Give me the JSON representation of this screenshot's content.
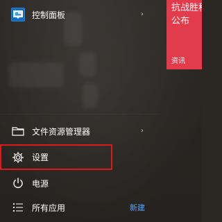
{
  "start_menu": {
    "control_panel": {
      "label": "控制面板",
      "icon": "control-panel-icon"
    },
    "file_explorer": {
      "label": "文件资源管理器",
      "icon": "folder-icon"
    },
    "settings": {
      "label": "设置",
      "icon": "gear-icon",
      "highlight_color": "#d81c1c"
    },
    "power": {
      "label": "电源",
      "icon": "power-icon"
    },
    "all_apps": {
      "label": "所有应用",
      "icon": "all-apps-icon"
    },
    "new_link": {
      "label": "新建",
      "color": "#55a7ff"
    },
    "chevron": "›"
  },
  "news_tile": {
    "headline": "抗战胜程公布",
    "label": "资讯",
    "color": "#e13b4c"
  }
}
